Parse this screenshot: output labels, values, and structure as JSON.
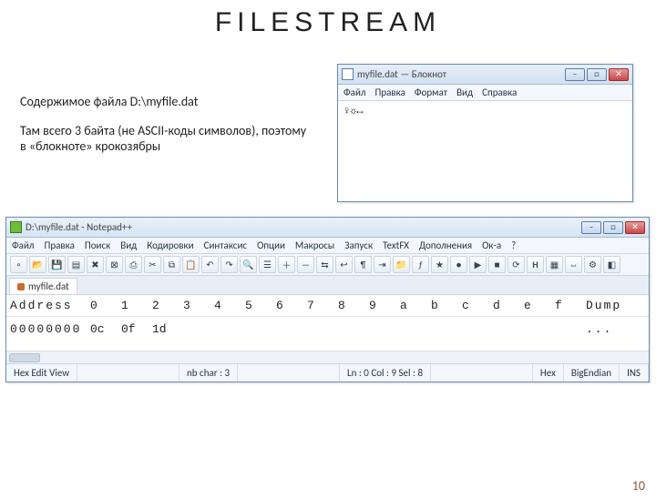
{
  "page": {
    "title": "FILESTREAM",
    "desc1": "Содержимое файла D:\\myfile.dat",
    "desc2": "Там всего 3 байта (не ASCII-коды символов), поэтому в «блокноте» крокозябры",
    "number": "10"
  },
  "notepad": {
    "title": "myfile.dat — Блокнот",
    "menu": [
      "Файл",
      "Правка",
      "Формат",
      "Вид",
      "Справка"
    ],
    "content": "♀☼↔"
  },
  "npp": {
    "title": "D:\\myfile.dat - Notepad++",
    "menu": [
      "Файл",
      "Правка",
      "Поиск",
      "Вид",
      "Кодировки",
      "Синтаксис",
      "Опции",
      "Макросы",
      "Запуск",
      "TextFX",
      "Дополнения",
      "Ок-а",
      "?"
    ],
    "tab": "myfile.dat",
    "hex": {
      "addrhead": "Address",
      "cols": [
        "0",
        "1",
        "2",
        "3",
        "4",
        "5",
        "6",
        "7",
        "8",
        "9",
        "a",
        "b",
        "c",
        "d",
        "e",
        "f"
      ],
      "dumphead": "Dump",
      "addr": "00000000",
      "bytes": [
        "0c",
        "0f",
        "1d",
        "",
        "",
        "",
        "",
        "",
        "",
        "",
        "",
        "",
        "",
        "",
        "",
        ""
      ],
      "dump": "..."
    },
    "status": {
      "view": "Hex Edit View",
      "nbchar": "nb char : 3",
      "pos": "Ln : 0   Col : 9   Sel : 8",
      "mode": "Hex",
      "endian": "BigEndian",
      "ins": "INS"
    }
  }
}
